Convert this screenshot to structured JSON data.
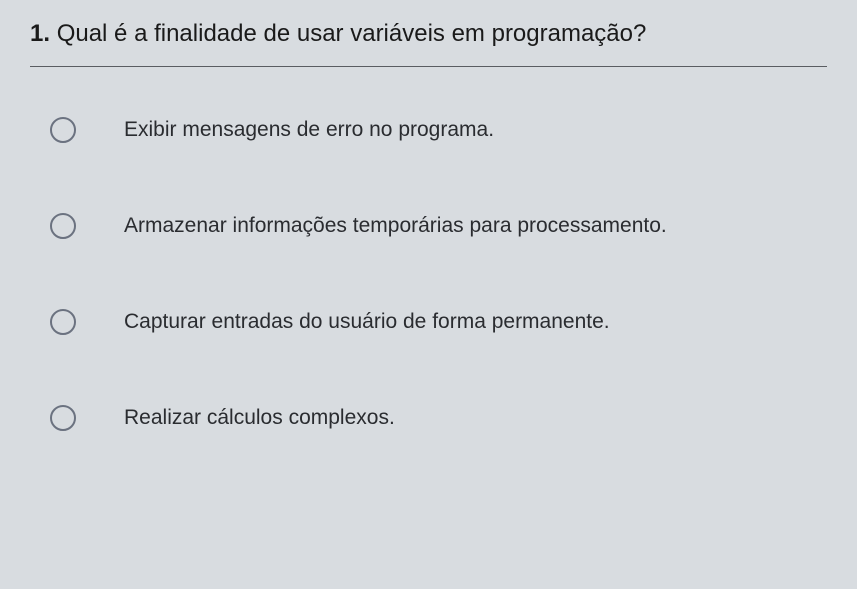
{
  "question": {
    "number": "1.",
    "text": "Qual é a finalidade de usar variáveis em programação?"
  },
  "options": [
    {
      "label": "Exibir mensagens de erro no programa."
    },
    {
      "label": "Armazenar informações temporárias para processamento."
    },
    {
      "label": "Capturar entradas do usuário de forma permanente."
    },
    {
      "label": "Realizar cálculos complexos."
    }
  ]
}
